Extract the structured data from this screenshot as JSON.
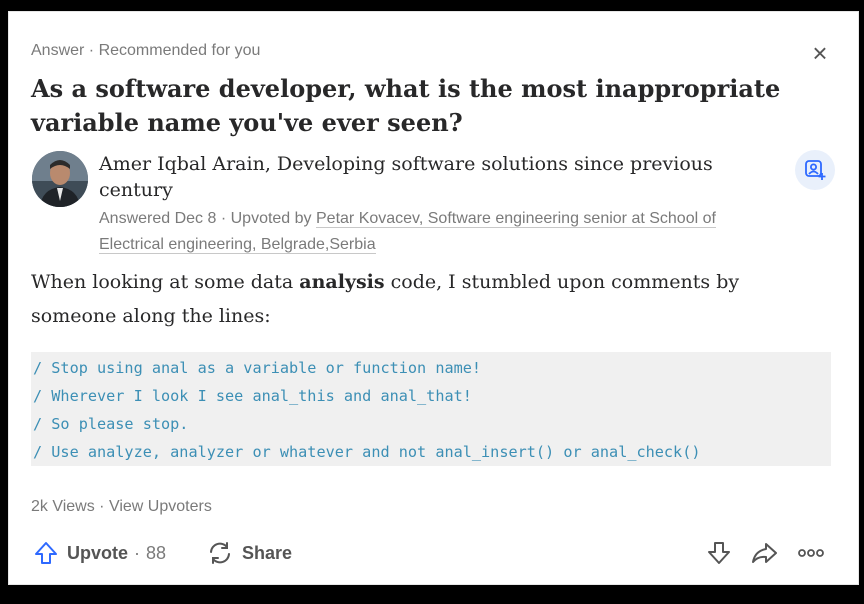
{
  "header": {
    "meta": "Answer · Recommended for you",
    "close_icon": "close-icon"
  },
  "question": {
    "title": "As a software developer, what is the most inappropriate variable name you've ever seen?"
  },
  "author": {
    "line": "Amer Iqbal Arain, Developing software solutions since previous century",
    "answered_prefix": "Answered Dec 8 · Upvoted by ",
    "upvoter": "Petar Kovacev, Software engineering senior at School of Electrical engineering, Belgrade,Serbia"
  },
  "body": {
    "intro_before": "When looking at some data ",
    "intro_bold": "analysis",
    "intro_after": " code, I stumbled upon comments by someone along the lines:",
    "code_lines": [
      "/ Stop using anal as a variable or function name!",
      "/ Wherever I look I see anal_this and anal_that!",
      "/ So please stop.",
      "/ Use analyze, analyzer or whatever and not anal_insert() or anal_check()"
    ]
  },
  "stats": {
    "views": "2k Views",
    "sep": " · ",
    "view_upvoters": "View Upvoters"
  },
  "actions": {
    "upvote_label": "Upvote",
    "upvote_sep": "·",
    "upvote_count": "88",
    "share_label": "Share"
  },
  "colors": {
    "accent": "#2e69ff",
    "code_text": "#3c8fb5",
    "muted": "#7a7a7a"
  }
}
